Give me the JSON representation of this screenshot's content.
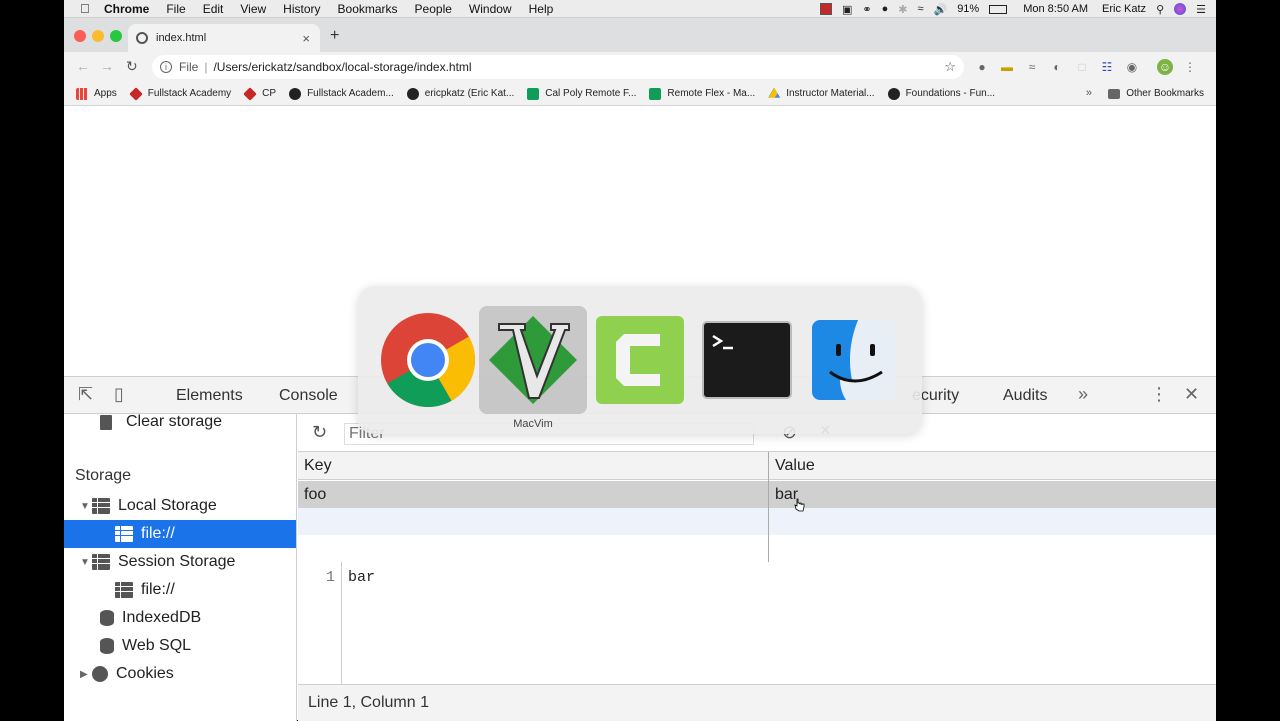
{
  "menubar": {
    "app_name": "Chrome",
    "items": [
      "File",
      "Edit",
      "View",
      "History",
      "Bookmarks",
      "People",
      "Window",
      "Help"
    ],
    "battery": "91%",
    "clock": "Mon 8:50 AM",
    "user": "Eric Katz"
  },
  "browser": {
    "tab_title": "index.html",
    "url_scheme": "File",
    "url_path": "/Users/erickatz/sandbox/local-storage/index.html",
    "bookmarks": [
      {
        "label": "Apps",
        "icon": "apps-grid-icon",
        "color": "#e8453c"
      },
      {
        "label": "Fullstack Academy",
        "icon": "fullstack-icon",
        "color": "#c62828"
      },
      {
        "label": "CP",
        "icon": "cp-icon",
        "color": "#c62828"
      },
      {
        "label": "Fullstack Academ...",
        "icon": "github-icon",
        "color": "#222222"
      },
      {
        "label": "ericpkatz (Eric Kat...",
        "icon": "github-icon",
        "color": "#222222"
      },
      {
        "label": "Cal Poly Remote F...",
        "icon": "sheets-icon",
        "color": "#0f9d58"
      },
      {
        "label": "Remote Flex - Ma...",
        "icon": "sheets-icon",
        "color": "#0f9d58"
      },
      {
        "label": "Instructor Material...",
        "icon": "drive-icon",
        "color": "#fbbc04"
      },
      {
        "label": "Foundations - Fun...",
        "icon": "github-icon",
        "color": "#222222"
      }
    ],
    "other_bookmarks": "Other Bookmarks"
  },
  "devtools": {
    "tabs": [
      "Elements",
      "Console",
      "ecurity",
      "Audits"
    ],
    "sidebar": {
      "clear_storage": "Clear storage",
      "storage_heading": "Storage",
      "local_storage": "Local Storage",
      "local_storage_child": "file://",
      "session_storage": "Session Storage",
      "session_storage_child": "file://",
      "indexeddb": "IndexedDB",
      "websql": "Web SQL",
      "cookies": "Cookies"
    },
    "filter_placeholder": "Filter",
    "table": {
      "headers": [
        "Key",
        "Value"
      ],
      "rows": [
        {
          "key": "foo",
          "value": "bar"
        }
      ]
    },
    "preview": {
      "line_number": "1",
      "code": "bar"
    },
    "status": "Line 1, Column 1"
  },
  "app_switcher": {
    "apps": [
      {
        "name": "chrome-app-icon"
      },
      {
        "name": "macvim-app-icon"
      },
      {
        "name": "camtasia-app-icon"
      },
      {
        "name": "terminal-app-icon"
      },
      {
        "name": "finder-app-icon"
      }
    ],
    "selected_label": "MacVim"
  },
  "colors": {
    "selection_blue": "#1a73e8",
    "macvim_green": "#2e9a3a",
    "camtasia_green": "#8fd14f"
  }
}
